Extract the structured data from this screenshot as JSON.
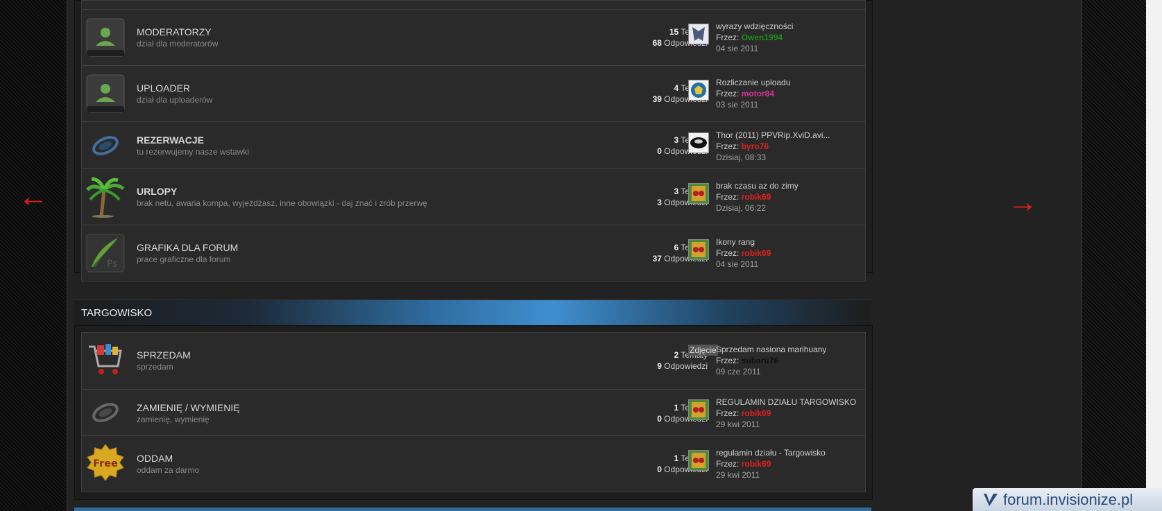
{
  "site": {
    "watermark": "forum.invisionize.pl"
  },
  "stats_labels": {
    "topics": "Tematy",
    "replies": "Odpowiedzi",
    "by": "Frzez:"
  },
  "sections": [
    {
      "title": "",
      "forums": [
        {
          "name": "MODERATORZY",
          "desc": "dział dla moderatorów",
          "topics": "15",
          "replies": "68",
          "last": {
            "title": "wyrazy wdzięczności",
            "by_label": "Frzez:",
            "user": "Owen1994",
            "user_color": "#1a8f1a",
            "date": "04 sie 2011"
          },
          "icon": "user-icon",
          "bold": false
        },
        {
          "name": "UPLOADER",
          "desc": "dział dla uploaderów",
          "topics": "4",
          "replies": "39",
          "last": {
            "title": "Rozliczanie uploadu",
            "by_label": "Frzez:",
            "user": "motor84",
            "user_color": "#d0309a",
            "date": "03 sie 2011"
          },
          "icon": "user-icon",
          "bold": false
        },
        {
          "name": "REZERWACJE",
          "desc": "tu rezerwujemy nasze wstawki",
          "topics": "3",
          "replies": "0",
          "last": {
            "title": "Thor (2011) PPVRip.XviD.avi...",
            "by_label": "Frzez:",
            "user": "byro76",
            "user_color": "#e02020",
            "date": "Dzisiaj, 08:33"
          },
          "icon": "swirl-icon",
          "bold": true
        },
        {
          "name": "URLOPY",
          "desc": "brak netu, awaria kompa, wyjeżdżasz, inne obowiązki - daj znać i zrób przerwę",
          "topics": "3",
          "replies": "3",
          "last": {
            "title": "brak czasu az do zimy",
            "by_label": "Frzez:",
            "user": "robik69",
            "user_color": "#e02020",
            "date": "Dzisiaj, 06:22"
          },
          "icon": "palm-tree-icon",
          "bold": true
        },
        {
          "name": "GRAFIKA DLA FORUM",
          "desc": "prace graficzne dla forum",
          "topics": "6",
          "replies": "37",
          "last": {
            "title": "Ikony rang",
            "by_label": "Frzez:",
            "user": "robik69",
            "user_color": "#e02020",
            "date": "04 sie 2011"
          },
          "icon": "feather-ps-icon",
          "bold": false
        }
      ]
    },
    {
      "title": "TARGOWISKO",
      "forums": [
        {
          "name": "SPRZEDAM",
          "desc": "sprzedam",
          "topics": "2",
          "replies": "9",
          "last": {
            "title": "Sprzedam nasiona marihuany",
            "by_label": "Frzez:",
            "user": "subaru76",
            "user_color": "#111111",
            "date": "09 cze 2011"
          },
          "icon": "shopping-cart-icon",
          "bold": false,
          "avatar_text": "Zdjęcie"
        },
        {
          "name": "ZAMIENIĘ / WYMIENIĘ",
          "desc": "zamienię, wymienię",
          "topics": "1",
          "replies": "0",
          "last": {
            "title": "REGULAMIN DZIAŁU TARGOWISKO",
            "by_label": "Frzez:",
            "user": "robik69",
            "user_color": "#e02020",
            "date": "29 kwi 2011"
          },
          "icon": "swirl-icon",
          "bold": false
        },
        {
          "name": "ODDAM",
          "desc": "oddam za darmo",
          "topics": "1",
          "replies": "0",
          "last": {
            "title": "regulamin działu - Targowisko",
            "by_label": "Frzez:",
            "user": "robik69",
            "user_color": "#e02020",
            "date": "29 kwi 2011"
          },
          "icon": "free-badge-icon",
          "bold": false,
          "badge_text": "Free"
        }
      ]
    }
  ],
  "colors": {
    "accent": "#3f8fd0",
    "arrow": "#e02020"
  }
}
